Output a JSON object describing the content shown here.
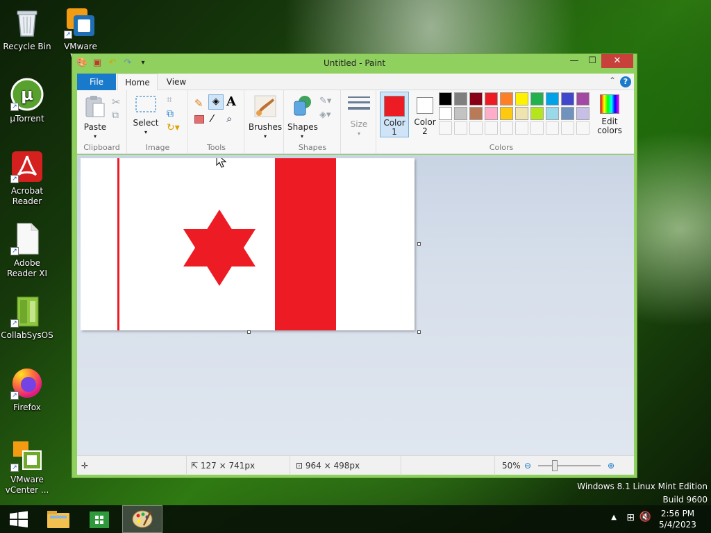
{
  "desktop": {
    "icons": [
      {
        "label": "Recycle Bin"
      },
      {
        "label": "VMware Wo..."
      },
      {
        "label": "µTorrent"
      },
      {
        "label": "Acrobat Reader"
      },
      {
        "label": "Adobe Reader XI"
      },
      {
        "label": "CollabSysOS"
      },
      {
        "label": "Firefox"
      },
      {
        "label": "VMware vCenter ..."
      }
    ]
  },
  "window": {
    "title": "Untitled - Paint",
    "tabs": {
      "file": "File",
      "home": "Home",
      "view": "View"
    },
    "ribbon": {
      "clipboard": {
        "label": "Clipboard",
        "paste": "Paste"
      },
      "image": {
        "label": "Image",
        "select": "Select"
      },
      "tools": {
        "label": "Tools"
      },
      "brushes": {
        "label": "Brushes"
      },
      "shapes": {
        "label": "Shapes",
        "shapes_btn": "Shapes"
      },
      "size": {
        "label": "Size"
      },
      "colors": {
        "label": "Colors",
        "color1_line1": "Color",
        "color1_line2": "1",
        "color2_line1": "Color",
        "color2_line2": "2",
        "edit_line1": "Edit",
        "edit_line2": "colors",
        "color1": "#ed1c24",
        "color2": "#ffffff",
        "palette_row1": [
          "#000000",
          "#7f7f7f",
          "#880015",
          "#ed1c24",
          "#ff7f27",
          "#fff200",
          "#22b14c",
          "#00a2e8",
          "#3f48cc",
          "#a349a4"
        ],
        "palette_row2": [
          "#ffffff",
          "#c3c3c3",
          "#b97a57",
          "#ffaec9",
          "#ffc90e",
          "#efe4b0",
          "#b5e61d",
          "#99d9ea",
          "#7092be",
          "#c8bfe7"
        ]
      }
    },
    "status": {
      "cursor_pos": "127 × 741px",
      "canvas_size": "964 × 498px",
      "zoom": "50%"
    },
    "flag_red": "#ed1c24"
  },
  "os": {
    "edition": "Windows 8.1 Linux Mint Edition",
    "build": "Build 9600",
    "time": "2:56 PM",
    "date": "5/4/2023"
  }
}
